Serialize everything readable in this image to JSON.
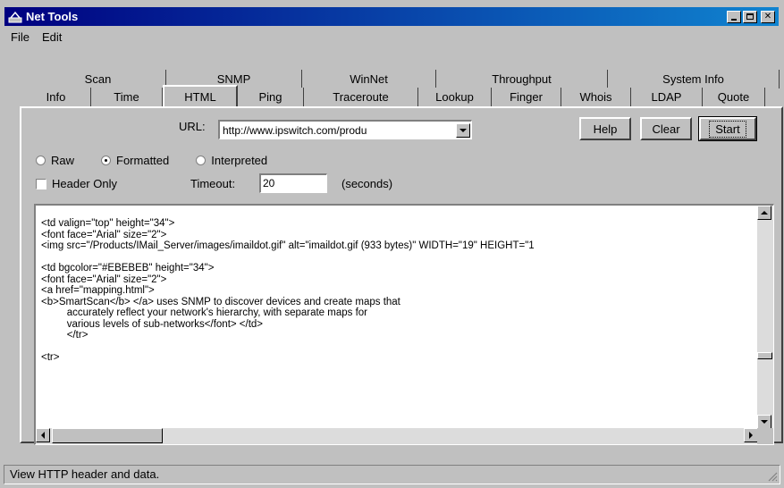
{
  "window": {
    "title": "Net Tools"
  },
  "menu": {
    "file": "File",
    "edit": "Edit"
  },
  "tabs_upper": [
    "Scan",
    "SNMP",
    "WinNet",
    "Throughput",
    "System Info"
  ],
  "tabs_lower": [
    "Info",
    "Time",
    "HTML",
    "Ping",
    "Traceroute",
    "Lookup",
    "Finger",
    "Whois",
    "LDAP",
    "Quote"
  ],
  "active_tab": "HTML",
  "url": {
    "label": "URL:",
    "value": "http://www.ipswitch.com/produ"
  },
  "buttons": {
    "help": "Help",
    "clear": "Clear",
    "start": "Start"
  },
  "modes": [
    {
      "label": "Raw",
      "selected": false
    },
    {
      "label": "Formatted",
      "selected": true
    },
    {
      "label": "Interpreted",
      "selected": false
    }
  ],
  "header_only": {
    "label": "Header Only",
    "checked": false
  },
  "timeout": {
    "label": "Timeout:",
    "value": "20",
    "unit": "(seconds)"
  },
  "output": {
    "lines": [
      "<td valign=\"top\" height=\"34\">",
      "<font face=\"Arial\" size=\"2\">",
      "<img src=\"/Products/IMail_Server/images/imaildot.gif\" alt=\"imaildot.gif (933 bytes)\" WIDTH=\"19\" HEIGHT=\"1",
      "",
      "<td bgcolor=\"#EBEBEB\" height=\"34\">",
      "<font face=\"Arial\" size=\"2\">",
      "<a href=\"mapping.html\">",
      "<b>SmartScan</b> </a> uses SNMP to discover devices and create maps that",
      "         accurately reflect your network's hierarchy, with separate maps for",
      "         various levels of sub-networks</font> </td>",
      "         </tr>",
      "",
      "<tr>"
    ]
  },
  "status": {
    "text": "View HTTP header and data."
  }
}
